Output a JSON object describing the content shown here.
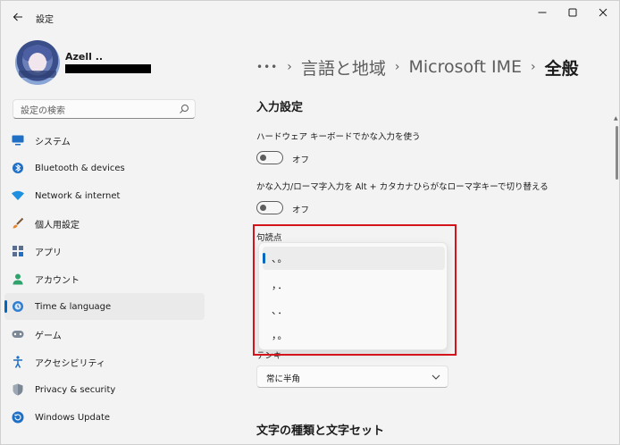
{
  "window": {
    "title": "設定"
  },
  "profile": {
    "name": "Azell .."
  },
  "search": {
    "placeholder": "設定の検索"
  },
  "sidebar": {
    "items": [
      {
        "label": "システム",
        "icon": "monitor-icon",
        "active": false
      },
      {
        "label": "Bluetooth & devices",
        "icon": "bluetooth-icon",
        "active": false
      },
      {
        "label": "Network & internet",
        "icon": "wifi-icon",
        "active": false
      },
      {
        "label": "個人用設定",
        "icon": "brush-icon",
        "active": false
      },
      {
        "label": "アプリ",
        "icon": "apps-icon",
        "active": false
      },
      {
        "label": "アカウント",
        "icon": "person-icon",
        "active": false
      },
      {
        "label": "Time & language",
        "icon": "globe-clock-icon",
        "active": true
      },
      {
        "label": "ゲーム",
        "icon": "gamepad-icon",
        "active": false
      },
      {
        "label": "アクセシビリティ",
        "icon": "accessibility-icon",
        "active": false
      },
      {
        "label": "Privacy & security",
        "icon": "shield-icon",
        "active": false
      },
      {
        "label": "Windows Update",
        "icon": "update-icon",
        "active": false
      }
    ]
  },
  "breadcrumb": {
    "ellipsis": "•••",
    "sep": "›",
    "parts": [
      "言語と地域",
      "Microsoft IME"
    ],
    "current": "全般"
  },
  "main": {
    "section_input": "入力設定",
    "setting1_label": "ハードウェア キーボードでかな入力を使う",
    "setting1_state": "オフ",
    "setting2_label": "かな入力/ローマ字入力を Alt + カタカナひらがなローマ字キーで切り替える",
    "setting2_state": "オフ",
    "punct_label": "句読点",
    "punct_options": [
      "、。",
      "，．",
      "、．",
      "，。"
    ],
    "punct_selected": 0,
    "tenkey_label": "テンキー",
    "tenkey_value": "常に半角",
    "section_chars": "文字の種類と文字セット"
  },
  "colors": {
    "accent": "#0067c0",
    "highlight": "#d4141b"
  }
}
